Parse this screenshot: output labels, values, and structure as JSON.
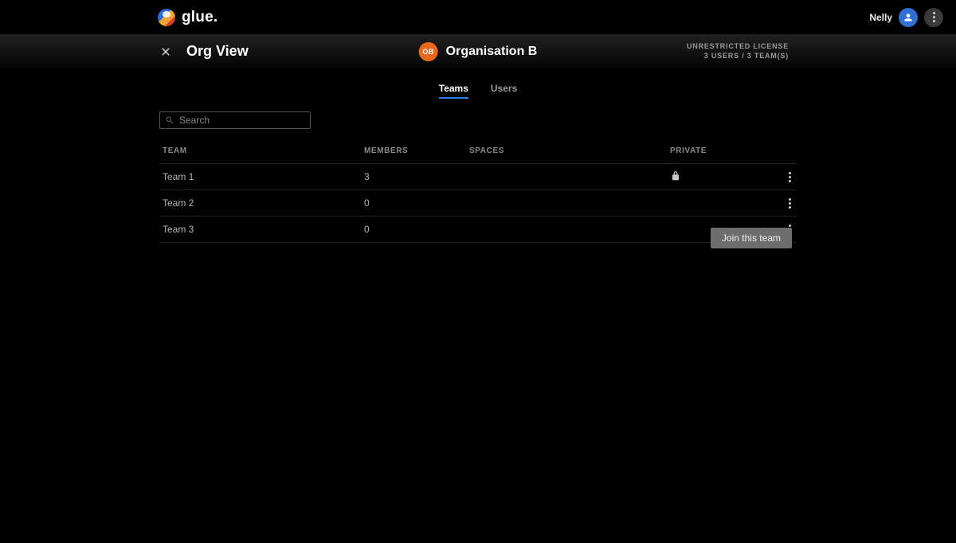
{
  "brand": {
    "name": "glue."
  },
  "user": {
    "name": "Nelly"
  },
  "page": {
    "title": "Org View"
  },
  "org": {
    "badge": "OB",
    "name": "Organisation B"
  },
  "license": {
    "line1": "UNRESTRICTED LICENSE",
    "line2": "3 USERS / 3 TEAM(S)"
  },
  "tabs": {
    "teams": "Teams",
    "users": "Users"
  },
  "search": {
    "placeholder": "Search",
    "value": ""
  },
  "columns": {
    "team": "TEAM",
    "members": "MEMBERS",
    "spaces": "SPACES",
    "private": "PRIVATE"
  },
  "rows": [
    {
      "team": "Team 1",
      "members": "3",
      "spaces": "",
      "private": true
    },
    {
      "team": "Team 2",
      "members": "0",
      "spaces": "",
      "private": false
    },
    {
      "team": "Team 3",
      "members": "0",
      "spaces": "",
      "private": false
    }
  ],
  "popover": {
    "join": "Join this team"
  }
}
